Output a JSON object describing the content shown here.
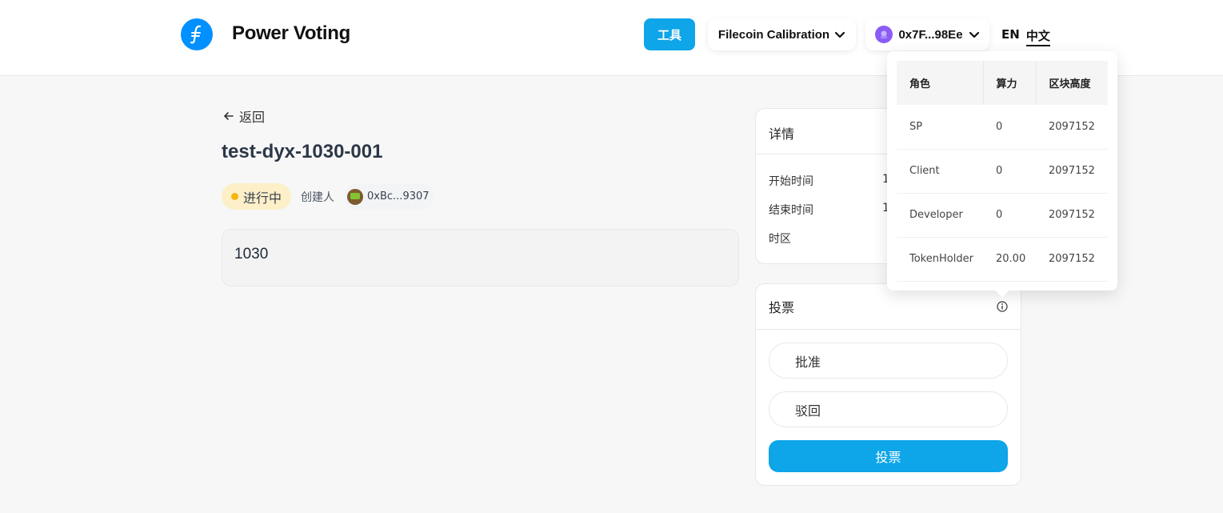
{
  "header": {
    "brand": "Power Voting",
    "tools_label": "工具",
    "network_label": "Filecoin Calibration",
    "account_label": "0x7F...98Ee",
    "lang_en": "EN",
    "lang_zh": "中文"
  },
  "proposal": {
    "back_label": "返回",
    "title": "test-dyx-1030-001",
    "status": "进行中",
    "creator_label": "创建人",
    "creator_address": "0xBc...9307",
    "description": "1030"
  },
  "details": {
    "title": "详情",
    "rows": [
      {
        "label": "开始时间",
        "value": "1"
      },
      {
        "label": "结束时间",
        "value": "1"
      },
      {
        "label": "时区",
        "value": ""
      }
    ]
  },
  "vote": {
    "title": "投票",
    "options": [
      "批准",
      "驳回"
    ],
    "submit_label": "投票"
  },
  "power_popover": {
    "headers": [
      "角色",
      "算力",
      "区块高度"
    ],
    "rows": [
      [
        "SP",
        "0",
        "2097152"
      ],
      [
        "Client",
        "0",
        "2097152"
      ],
      [
        "Developer",
        "0",
        "2097152"
      ],
      [
        "TokenHolder",
        "20.00",
        "2097152"
      ]
    ]
  },
  "colors": {
    "accent": "#0ea5e9",
    "status_bg": "#fdefc8",
    "status_dot": "#f5b50a",
    "logo": "#0090ff"
  }
}
